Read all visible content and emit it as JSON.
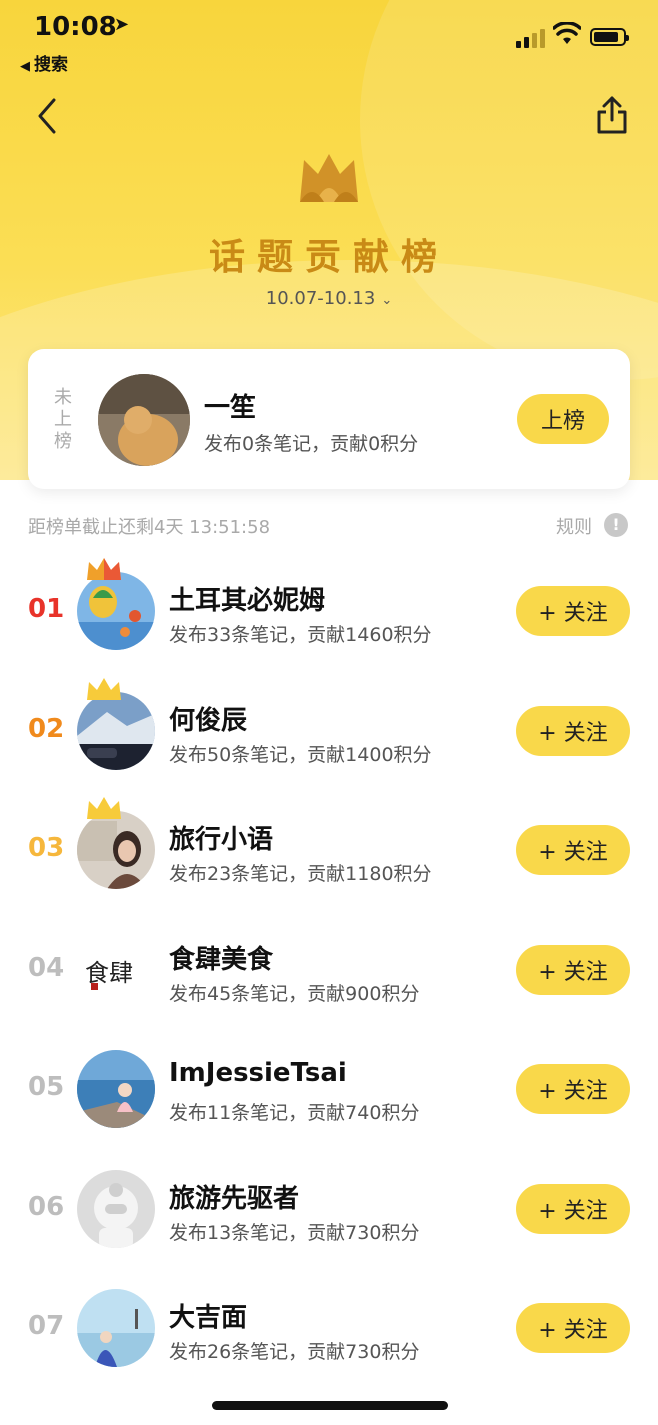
{
  "status": {
    "time": "10:08",
    "back_app": "搜索"
  },
  "header": {
    "title": "话题贡献榜",
    "period": "10.07-10.13"
  },
  "my_entry": {
    "rank_label": "未上榜",
    "name": "一笙",
    "stats": "发布0条笔记，贡献0积分",
    "button": "上榜"
  },
  "deadline": "距榜单截止还剩4天 13:51:58",
  "rules_label": "规则",
  "rules_icon": "!",
  "follow_label": "+ 关注",
  "ranking": [
    {
      "rank": "01",
      "name": "土耳其必妮姆",
      "stats": "发布33条笔记，贡献1460积分"
    },
    {
      "rank": "02",
      "name": "何俊辰",
      "stats": "发布50条笔记，贡献1400积分"
    },
    {
      "rank": "03",
      "name": "旅行小语",
      "stats": "发布23条笔记，贡献1180积分"
    },
    {
      "rank": "04",
      "name": "食肆美食",
      "stats": "发布45条笔记，贡献900积分"
    },
    {
      "rank": "05",
      "name": "ImJessieTsai",
      "stats": "发布11条笔记，贡献740积分"
    },
    {
      "rank": "06",
      "name": "旅游先驱者",
      "stats": "发布13条笔记，贡献730积分"
    },
    {
      "rank": "07",
      "name": "大吉面",
      "stats": "发布26条笔记，贡献730积分"
    }
  ],
  "colors": {
    "accent": "#f9d84a",
    "rank1": "#e8332a",
    "rank2": "#f08a1c",
    "rank3": "#f6b73c",
    "rank_other": "#bdbdbd",
    "title": "#c98a16"
  },
  "icons": [
    "back-chevron-icon",
    "share-icon",
    "crown-icon",
    "chevron-down-icon",
    "signal-icon",
    "wifi-icon",
    "battery-icon",
    "location-arrow-icon"
  ]
}
